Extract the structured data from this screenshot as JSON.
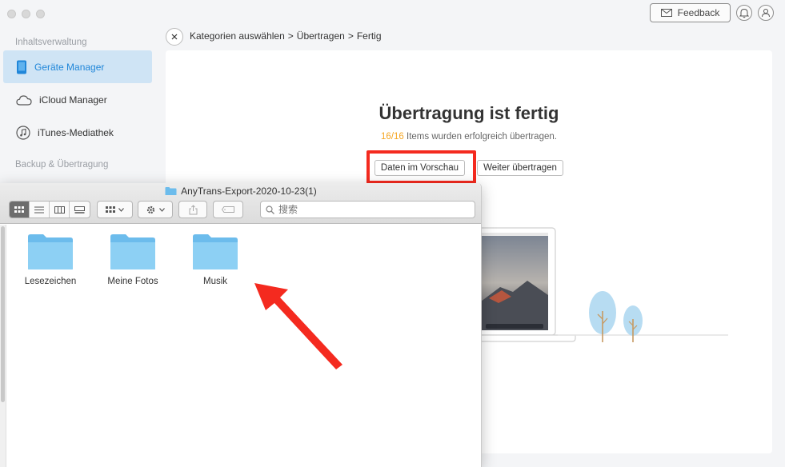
{
  "header": {
    "feedback_label": "Feedback"
  },
  "sidebar": {
    "section_content": "Inhaltsverwaltung",
    "section_backup": "Backup & Übertragung",
    "items": [
      {
        "label": "Geräte Manager",
        "icon": "device-icon",
        "active": true
      },
      {
        "label": "iCloud Manager",
        "icon": "cloud-icon",
        "active": false
      },
      {
        "label": "iTunes-Mediathek",
        "icon": "music-note-icon",
        "active": false
      }
    ]
  },
  "breadcrumb": {
    "step1": "Kategorien auswählen",
    "sep": ">",
    "step2": "Übertragen",
    "step3": "Fertig"
  },
  "result": {
    "title": "Übertragung ist fertig",
    "count": "16/16",
    "message": "Items wurden erfolgreich übertragen.",
    "preview_button": "Daten im Vorschau",
    "continue_button": "Weiter übertragen"
  },
  "finder": {
    "title": "AnyTrans-Export-2020-10-23(1)",
    "search_placeholder": "搜索",
    "folders": [
      {
        "label": "Lesezeichen"
      },
      {
        "label": "Meine Fotos"
      },
      {
        "label": "Musik"
      }
    ]
  },
  "colors": {
    "accent": "#1f86d9",
    "highlight": "#f42a1f",
    "count": "#f5a623",
    "folder": "#7cc5ef"
  }
}
